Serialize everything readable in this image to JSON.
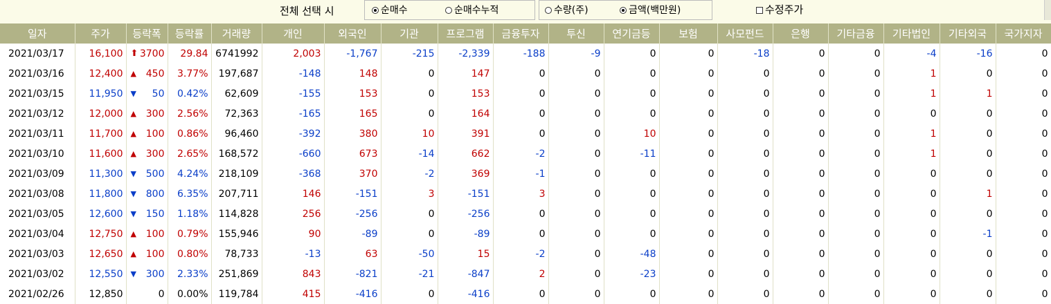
{
  "toolbar": {
    "select_label": "전체 선택 시",
    "opt_net_buy": "순매수",
    "opt_net_buy_cum": "순매수누적",
    "opt_qty": "수량(주)",
    "opt_amount": "금액(백만원)",
    "opt_adj_price": "수정주가"
  },
  "colors": {
    "header_bg": "#b1b387",
    "up": "#c00000",
    "down": "#0a3ec8"
  },
  "table": {
    "headers": [
      "일자",
      "주가",
      "등락폭",
      "등락률",
      "거래량",
      "개인",
      "외국인",
      "기관",
      "프로그램",
      "금융투자",
      "투신",
      "연기금등",
      "보험",
      "사모펀드",
      "은행",
      "기타금융",
      "기타법인",
      "기타외국",
      "국가지자"
    ],
    "rows": [
      {
        "date": "2021/03/17",
        "price": "16,100",
        "dir": "upper",
        "chg": "3700",
        "rate": "29.84",
        "vol": "6741992",
        "v": [
          "2,003",
          "-1,767",
          "-215",
          "-2,339",
          "-188",
          "-9",
          "0",
          "0",
          "-18",
          "0",
          "0",
          "-4",
          "-16",
          "0"
        ]
      },
      {
        "date": "2021/03/16",
        "price": "12,400",
        "dir": "up",
        "chg": "450",
        "rate": "3.77%",
        "vol": "197,687",
        "v": [
          "-148",
          "148",
          "0",
          "147",
          "0",
          "0",
          "0",
          "0",
          "0",
          "0",
          "0",
          "1",
          "0",
          "0"
        ]
      },
      {
        "date": "2021/03/15",
        "price": "11,950",
        "dir": "down",
        "chg": "50",
        "rate": "0.42%",
        "vol": "62,609",
        "v": [
          "-155",
          "153",
          "0",
          "153",
          "0",
          "0",
          "0",
          "0",
          "0",
          "0",
          "0",
          "1",
          "1",
          "0"
        ]
      },
      {
        "date": "2021/03/12",
        "price": "12,000",
        "dir": "up",
        "chg": "300",
        "rate": "2.56%",
        "vol": "72,363",
        "v": [
          "-165",
          "165",
          "0",
          "164",
          "0",
          "0",
          "0",
          "0",
          "0",
          "0",
          "0",
          "0",
          "0",
          "0"
        ]
      },
      {
        "date": "2021/03/11",
        "price": "11,700",
        "dir": "up",
        "chg": "100",
        "rate": "0.86%",
        "vol": "96,460",
        "v": [
          "-392",
          "380",
          "10",
          "391",
          "0",
          "0",
          "10",
          "0",
          "0",
          "0",
          "0",
          "1",
          "0",
          "0"
        ]
      },
      {
        "date": "2021/03/10",
        "price": "11,600",
        "dir": "up",
        "chg": "300",
        "rate": "2.65%",
        "vol": "168,572",
        "v": [
          "-660",
          "673",
          "-14",
          "662",
          "-2",
          "0",
          "-11",
          "0",
          "0",
          "0",
          "0",
          "1",
          "0",
          "0"
        ]
      },
      {
        "date": "2021/03/09",
        "price": "11,300",
        "dir": "down",
        "chg": "500",
        "rate": "4.24%",
        "vol": "218,109",
        "v": [
          "-368",
          "370",
          "-2",
          "369",
          "-1",
          "0",
          "0",
          "0",
          "0",
          "0",
          "0",
          "0",
          "0",
          "0"
        ]
      },
      {
        "date": "2021/03/08",
        "price": "11,800",
        "dir": "down",
        "chg": "800",
        "rate": "6.35%",
        "vol": "207,711",
        "v": [
          "146",
          "-151",
          "3",
          "-151",
          "3",
          "0",
          "0",
          "0",
          "0",
          "0",
          "0",
          "0",
          "1",
          "0"
        ]
      },
      {
        "date": "2021/03/05",
        "price": "12,600",
        "dir": "down",
        "chg": "150",
        "rate": "1.18%",
        "vol": "114,828",
        "v": [
          "256",
          "-256",
          "0",
          "-256",
          "0",
          "0",
          "0",
          "0",
          "0",
          "0",
          "0",
          "0",
          "0",
          "0"
        ]
      },
      {
        "date": "2021/03/04",
        "price": "12,750",
        "dir": "up",
        "chg": "100",
        "rate": "0.79%",
        "vol": "155,946",
        "v": [
          "90",
          "-89",
          "0",
          "-89",
          "0",
          "0",
          "0",
          "0",
          "0",
          "0",
          "0",
          "0",
          "-1",
          "0"
        ]
      },
      {
        "date": "2021/03/03",
        "price": "12,650",
        "dir": "up",
        "chg": "100",
        "rate": "0.80%",
        "vol": "78,733",
        "v": [
          "-13",
          "63",
          "-50",
          "15",
          "-2",
          "0",
          "-48",
          "0",
          "0",
          "0",
          "0",
          "0",
          "0",
          "0"
        ]
      },
      {
        "date": "2021/03/02",
        "price": "12,550",
        "dir": "down",
        "chg": "300",
        "rate": "2.33%",
        "vol": "251,869",
        "v": [
          "843",
          "-821",
          "-21",
          "-847",
          "2",
          "0",
          "-23",
          "0",
          "0",
          "0",
          "0",
          "0",
          "0",
          "0"
        ]
      },
      {
        "date": "2021/02/26",
        "price": "12,850",
        "dir": "flat",
        "chg": "0",
        "rate": "0.00%",
        "vol": "119,784",
        "v": [
          "415",
          "-416",
          "0",
          "-416",
          "0",
          "0",
          "0",
          "0",
          "0",
          "0",
          "0",
          "0",
          "0",
          "0"
        ]
      }
    ]
  }
}
